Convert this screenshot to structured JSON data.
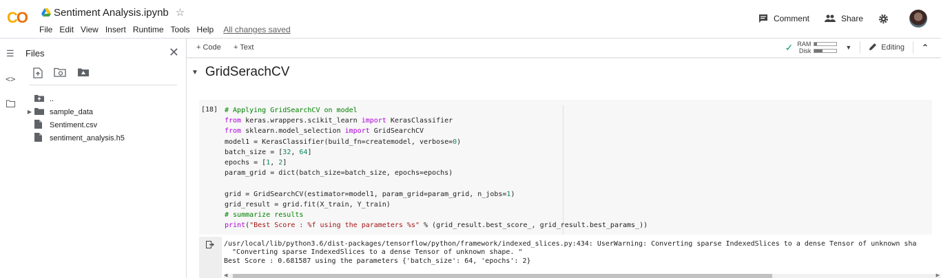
{
  "app": {
    "logo_text_1": "C",
    "logo_text_2": "O",
    "notebook_title": "Sentiment Analysis.ipynb",
    "menu": [
      "File",
      "Edit",
      "View",
      "Insert",
      "Runtime",
      "Tools",
      "Help"
    ],
    "save_status": "All changes saved",
    "comment_label": "Comment",
    "share_label": "Share"
  },
  "sidebar": {
    "title": "Files",
    "tree": [
      {
        "name": "..",
        "type": "parent-folder"
      },
      {
        "name": "sample_data",
        "type": "folder"
      },
      {
        "name": "Sentiment.csv",
        "type": "file"
      },
      {
        "name": "sentiment_analysis.h5",
        "type": "file"
      }
    ]
  },
  "toolbar": {
    "add_code": "Code",
    "add_text": "Text",
    "ram_label": "RAM",
    "disk_label": "Disk",
    "ram_usage": 0.1,
    "disk_usage": 0.35,
    "editing_label": "Editing"
  },
  "section": {
    "title": "GridSerachCV"
  },
  "cell": {
    "exec_count": "[18]",
    "output_lines": [
      "/usr/local/lib/python3.6/dist-packages/tensorflow/python/framework/indexed_slices.py:434: UserWarning: Converting sparse IndexedSlices to a dense Tensor of unknown sha",
      "  \"Converting sparse IndexedSlices to a dense Tensor of unknown shape. \"",
      "Best Score : 0.681587 using the parameters {'batch_size': 64, 'epochs': 2}"
    ]
  },
  "colors": {
    "logo_yellow": "#F9AB00",
    "logo_orange": "#E8710A",
    "code_keyword": "#af00db",
    "code_comment": "#008000",
    "code_number": "#098658",
    "code_string": "#a31515",
    "check_green": "#0f9d58"
  }
}
